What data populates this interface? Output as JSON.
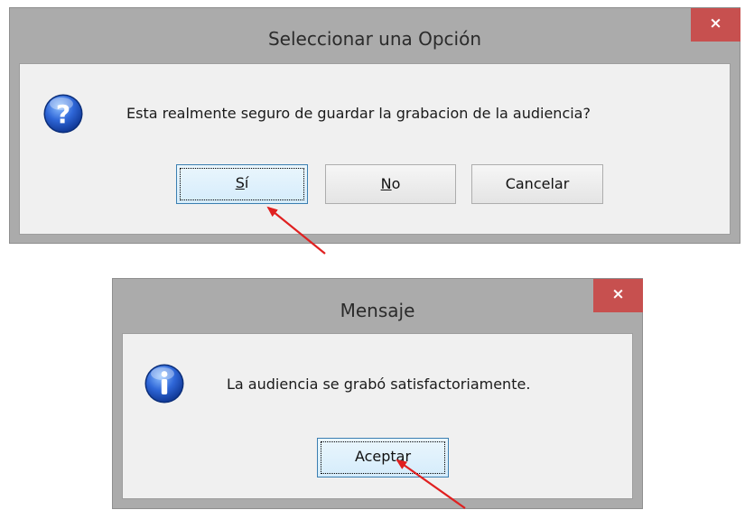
{
  "dialog1": {
    "title": "Seleccionar una Opción",
    "close_glyph": "×",
    "message": "Esta realmente seguro de guardar la grabacion de la audiencia?",
    "icon": "question-icon",
    "buttons": {
      "yes_mnemonic": "S",
      "yes_rest": "í",
      "no_mnemonic": "N",
      "no_rest": "o",
      "cancel": "Cancelar"
    }
  },
  "dialog2": {
    "title": "Mensaje",
    "close_glyph": "×",
    "message": "La audiencia se grabó satisfactoriamente.",
    "icon": "info-icon",
    "buttons": {
      "ok": "Aceptar"
    }
  },
  "annotations": {
    "arrow_color": "#e02020"
  },
  "colors": {
    "close_button": "#c7504f",
    "frame": "#ababab",
    "client": "#f0f0f0"
  }
}
